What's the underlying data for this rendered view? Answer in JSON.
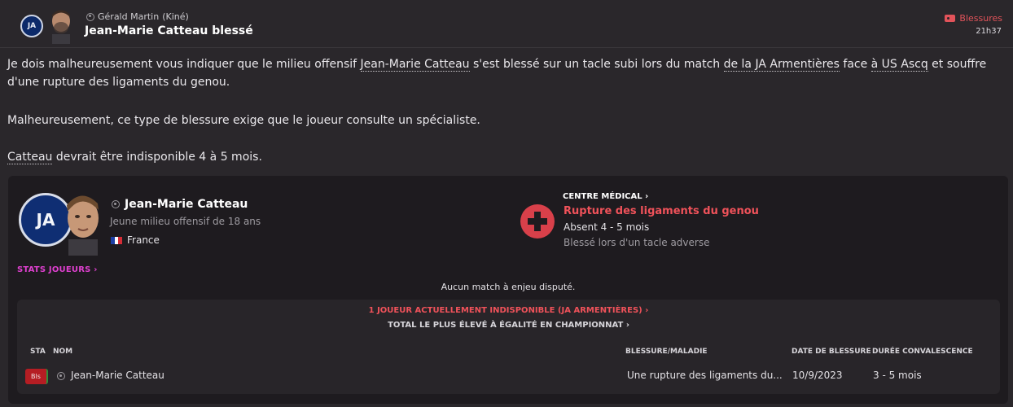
{
  "header": {
    "sender_name": "Gérald Martin",
    "sender_role": "(Kiné)",
    "subject": "Jean-Marie Catteau blessé",
    "tag_label": "Blessures",
    "time": "21h37",
    "club_badge_text": "JA"
  },
  "message": {
    "p1_part1": "Je dois malheureusement vous indiquer que le milieu offensif ",
    "p1_link_player": "Jean-Marie Catteau",
    "p1_part2": " s'est blessé sur un tacle subi lors du match ",
    "p1_link_club": "de la JA Armentières",
    "p1_part3": " face ",
    "p1_link_opponent": "à US Ascq",
    "p1_part4": " et souffre d'une rupture des ligaments du genou.",
    "p2": "Malheureusement, ce type de blessure exige que le joueur consulte un spécialiste.",
    "p3_link": "Catteau",
    "p3_rest": " devrait être indisponible 4 à 5 mois."
  },
  "card": {
    "player_name": "Jean-Marie Catteau",
    "player_desc": "Jeune milieu offensif de 18 ans",
    "nationality": "France",
    "stats_link": "STATS JOUEURS",
    "medical_centre": "CENTRE MÉDICAL",
    "injury": "Rupture des ligaments du genou",
    "absence": "Absent 4 - 5 mois",
    "cause": "Blessé lors d'un tacle adverse",
    "no_match": "Aucun match à enjeu disputé.",
    "club_badge_text": "JA"
  },
  "unavailable_panel": {
    "headline": "1 JOUEUR ACTUELLEMENT INDISPONIBLE (JA ARMENTIÈRES)",
    "subline": "TOTAL LE PLUS ÉLEVÉ À ÉGALITÉ EN CHAMPIONNAT",
    "columns": {
      "sta": "STA",
      "nom": "NOM",
      "blessure": "BLESSURE/MALADIE",
      "date": "DATE DE BLESSURE",
      "duree": "DURÉE CONVALESCENCE"
    },
    "rows": [
      {
        "status": "Bls",
        "name": "Jean-Marie Catteau",
        "injury": "Une rupture des ligaments du...",
        "date": "10/9/2023",
        "duration": "3 - 5 mois"
      }
    ]
  },
  "colors": {
    "accent_red": "#f0525a",
    "stats_pink": "#e040d0",
    "background": "#2a272b",
    "card": "#1e1b1f"
  }
}
